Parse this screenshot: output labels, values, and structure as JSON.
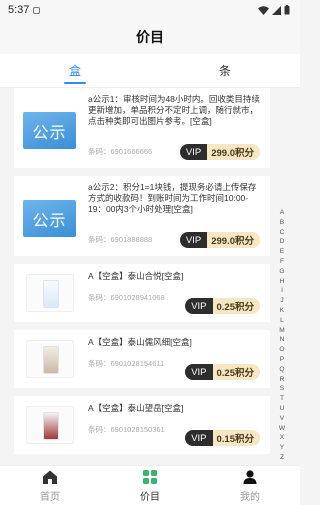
{
  "status_bar": {
    "time": "5:37"
  },
  "header": {
    "title": "价目"
  },
  "tabs": [
    {
      "label": "盒",
      "active": true
    },
    {
      "label": "条",
      "active": false
    }
  ],
  "items": [
    {
      "type": "notice",
      "image_text": "公示",
      "title": "a公示1：审核时间为48小时内。回收类目持续更新增加，单品积分不定时上调，随行就市，点击种类即可出图片参考。[空盒]",
      "barcode": "条码：6901666666",
      "vip": "VIP",
      "points": "299.0积分"
    },
    {
      "type": "notice",
      "image_text": "公示",
      "title": "a公示2：积分1=1块钱，提现务必请上传保存方式的收款码！到账时间为工作时间10:00-19：00内3个小时处理[空盒]",
      "barcode": "条码：6901888888",
      "vip": "VIP",
      "points": "299.0积分"
    },
    {
      "type": "product",
      "title": "A【空盒】泰山合悦[空盒]",
      "barcode": "条码：6901028941068",
      "vip": "VIP",
      "points": "0.25积分"
    },
    {
      "type": "product",
      "title": "A【空盒】泰山儒风细[空盒]",
      "barcode": "条码：6901028154611",
      "vip": "VIP",
      "points": "0.25积分"
    },
    {
      "type": "product",
      "title": "A【空盒】泰山望岳[空盒]",
      "barcode": "条码：6901028150361",
      "vip": "VIP",
      "points": "0.15积分"
    }
  ],
  "alpha_index": [
    "A",
    "B",
    "C",
    "D",
    "E",
    "F",
    "G",
    "H",
    "I",
    "J",
    "K",
    "L",
    "M",
    "N",
    "O",
    "P",
    "Q",
    "R",
    "S",
    "T",
    "U",
    "V",
    "W",
    "X",
    "Y",
    "Z"
  ],
  "bottom_nav": [
    {
      "label": "首页",
      "icon": "home-icon",
      "active": false
    },
    {
      "label": "价目",
      "icon": "grid-icon",
      "active": true
    },
    {
      "label": "我的",
      "icon": "person-icon",
      "active": false
    }
  ],
  "colors": {
    "accent": "#2a8cff",
    "vip_bg": "#2d2d2d",
    "points_bg": "#f5e7c4",
    "grid_green": "#3bb36b"
  }
}
